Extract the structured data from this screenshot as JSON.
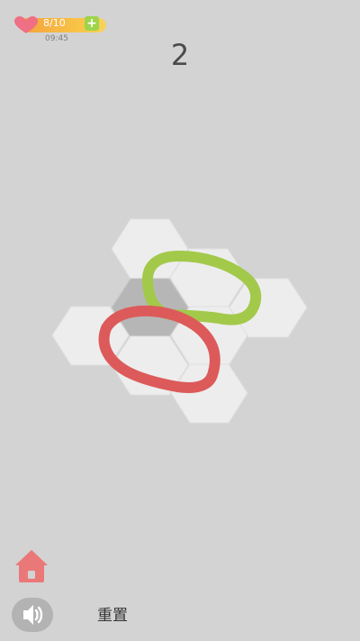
{
  "hud": {
    "lives": "8/10",
    "time": "09:45"
  },
  "level": {
    "number": "2"
  },
  "footer": {
    "reset_label": "重置"
  },
  "icons": {
    "heart": "heart-icon",
    "plus": "plus-icon",
    "home": "home-icon",
    "sound": "speaker-icon"
  },
  "colors": {
    "background": "#d3d3d3",
    "tile": "#ededed",
    "tile_dark": "#b6b6b6",
    "green_loop": "#a2c94a",
    "red_loop": "#dd5a5a",
    "heart": "#ef6f84",
    "home": "#eb7878"
  }
}
